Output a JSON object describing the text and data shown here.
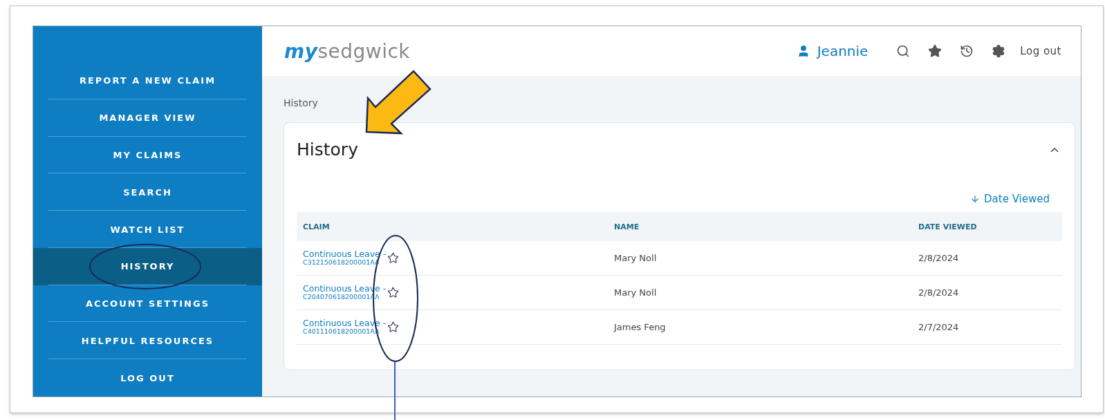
{
  "sidebar": {
    "items": [
      {
        "label": "REPORT A NEW CLAIM",
        "selected": false
      },
      {
        "label": "MANAGER VIEW",
        "selected": false
      },
      {
        "label": "MY CLAIMS",
        "selected": false
      },
      {
        "label": "SEARCH",
        "selected": false
      },
      {
        "label": "WATCH LIST",
        "selected": false
      },
      {
        "label": "HISTORY",
        "selected": true
      },
      {
        "label": "ACCOUNT SETTINGS",
        "selected": false
      },
      {
        "label": "HELPFUL RESOURCES",
        "selected": false
      },
      {
        "label": "LOG OUT",
        "selected": false
      }
    ]
  },
  "header": {
    "logo": {
      "prefix": "my",
      "name": "sedgwick"
    },
    "user": "Jeannie",
    "logout": "Log out"
  },
  "breadcrumb": "History",
  "card": {
    "title": "History",
    "expanded": true,
    "sort": "Date Viewed",
    "table": {
      "columns": [
        "CLAIM",
        "NAME",
        "DATE VIEWED"
      ],
      "rows": [
        {
          "claim": "Continuous Leave -",
          "claim_id": "C312150618200001AA",
          "starred": false,
          "name": "Mary Noll",
          "date": "2/8/2024"
        },
        {
          "claim": "Continuous Leave -",
          "claim_id": "C204070618200001AA",
          "starred": false,
          "name": "Mary Noll",
          "date": "2/8/2024"
        },
        {
          "claim": "Continuous Leave -",
          "claim_id": "C401110618200001AA",
          "starred": false,
          "name": "James Feng",
          "date": "2/7/2024"
        }
      ]
    }
  },
  "annotations": [
    {
      "kind": "arrow"
    },
    {
      "kind": "oval"
    },
    {
      "kind": "callout"
    }
  ]
}
